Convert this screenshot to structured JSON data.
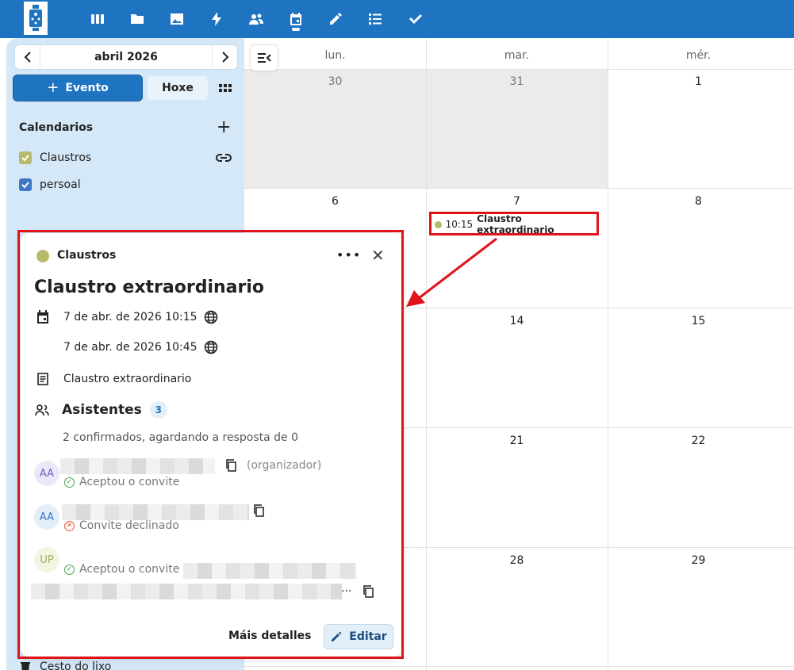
{
  "topbar": {
    "apps": [
      {
        "name": "dashboard-icon"
      },
      {
        "name": "files-icon"
      },
      {
        "name": "photos-icon"
      },
      {
        "name": "activity-icon"
      },
      {
        "name": "contacts-icon"
      },
      {
        "name": "calendar-icon",
        "active": true
      },
      {
        "name": "notes-icon"
      },
      {
        "name": "tasks-icon"
      },
      {
        "name": "checkmark-icon"
      }
    ],
    "accent_color": "#1f74c1"
  },
  "sidebar": {
    "month_label": "abril 2026",
    "new_event_label": "Evento",
    "today_label": "Hoxe",
    "calendars_heading": "Calendarios",
    "calendars": [
      {
        "label": "Claustros",
        "color": "#b7ba6b",
        "checked": true
      },
      {
        "label": "persoal",
        "color": "#3f77c4",
        "checked": true
      }
    ],
    "trash_label": "Cesto do lixo"
  },
  "grid": {
    "weekdays": [
      "lun.",
      "mar.",
      "mér."
    ],
    "weeks": [
      [
        "30",
        "31",
        "1"
      ],
      [
        "6",
        "7",
        "8"
      ],
      [
        "",
        "14",
        "15"
      ],
      [
        "",
        "21",
        "22"
      ],
      [
        "",
        "28",
        "29"
      ]
    ],
    "event": {
      "time": "10:15",
      "title": "Claustro extraordinario",
      "color": "#b7ba6b"
    }
  },
  "popover": {
    "calendar_name": "Claustros",
    "title": "Claustro extraordinario",
    "start": "7 de abr. de 2026 10:15",
    "end": "7 de abr. de 2026 10:45",
    "description": "Claustro extraordinario",
    "attendees_heading": "Asistentes",
    "attendees_count": "3",
    "attendees_summary": "2 confirmados, agardando a resposta de 0",
    "attendees": [
      {
        "initials": "AA",
        "status": "Aceptou o convite",
        "role": "(organizador)"
      },
      {
        "initials": "AA",
        "status": "Convite declinado"
      },
      {
        "initials": "UP",
        "status": "Aceptou o convite",
        "trailing": "..."
      }
    ],
    "more_details_label": "Máis detalles",
    "edit_label": "Editar"
  }
}
